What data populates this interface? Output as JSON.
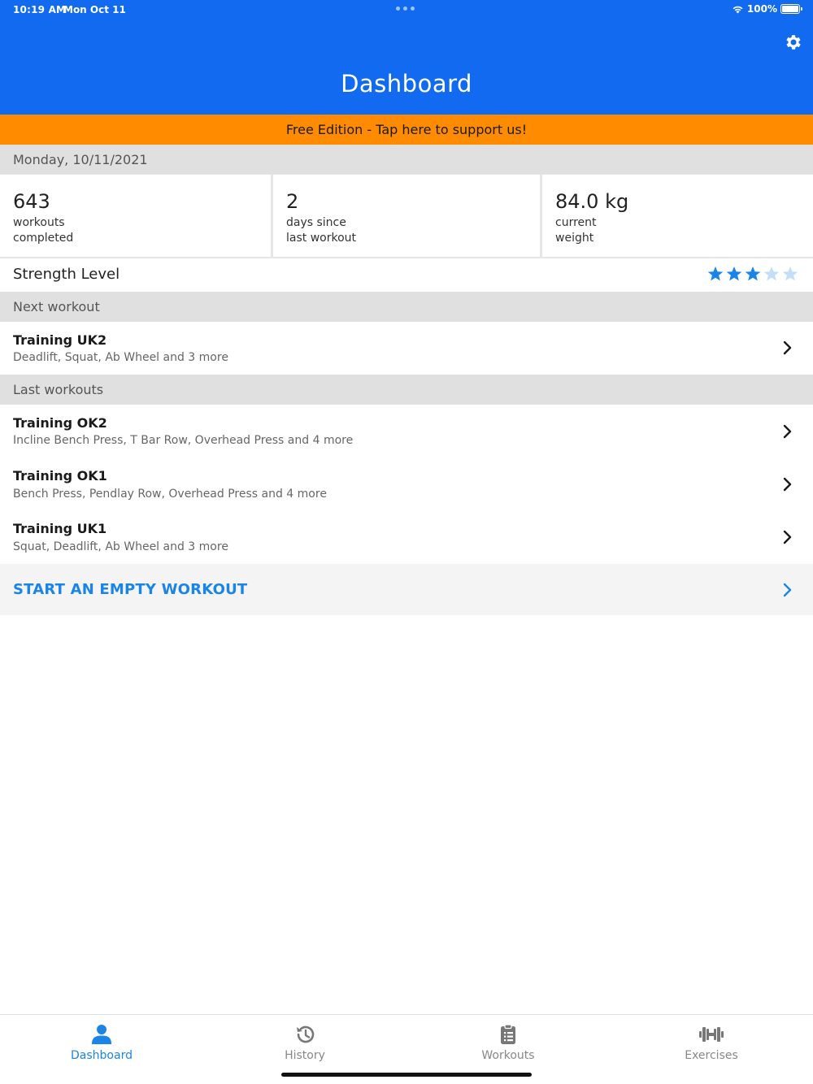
{
  "status_bar": {
    "time": "10:19 AM",
    "date": "Mon Oct 11",
    "battery": "100%"
  },
  "header": {
    "title": "Dashboard"
  },
  "promo": {
    "text": "Free Edition - Tap here to support us!"
  },
  "date_header": "Monday, 10/11/2021",
  "stats": [
    {
      "value": "643",
      "line1": "workouts",
      "line2": "completed"
    },
    {
      "value": "2",
      "line1": "days since",
      "line2": "last workout"
    },
    {
      "value": "84.0 kg",
      "line1": "current",
      "line2": "weight"
    }
  ],
  "strength": {
    "label": "Strength Level",
    "rating": 3,
    "max": 5
  },
  "next_workout": {
    "header": "Next workout",
    "title": "Training UK2",
    "subtitle": "Deadlift, Squat, Ab Wheel and 3 more"
  },
  "last_workouts": {
    "header": "Last workouts",
    "items": [
      {
        "title": "Training OK2",
        "subtitle": "Incline Bench Press, T Bar Row, Overhead Press and 4 more"
      },
      {
        "title": "Training OK1",
        "subtitle": "Bench Press, Pendlay Row, Overhead Press and 4 more"
      },
      {
        "title": "Training UK1",
        "subtitle": "Squat, Deadlift, Ab Wheel and 3 more"
      }
    ]
  },
  "empty_workout": {
    "label": "START AN EMPTY WORKOUT"
  },
  "tabs": [
    {
      "label": "Dashboard",
      "icon": "person-icon",
      "active": true
    },
    {
      "label": "History",
      "icon": "history-icon",
      "active": false
    },
    {
      "label": "Workouts",
      "icon": "clipboard-list-icon",
      "active": false
    },
    {
      "label": "Exercises",
      "icon": "dumbbell-icon",
      "active": false
    }
  ],
  "colors": {
    "header": "#116af0",
    "promo": "#ff8c00",
    "accent": "#1a84e8",
    "star_filled": "#1a84e8",
    "star_empty": "#c4def8"
  }
}
